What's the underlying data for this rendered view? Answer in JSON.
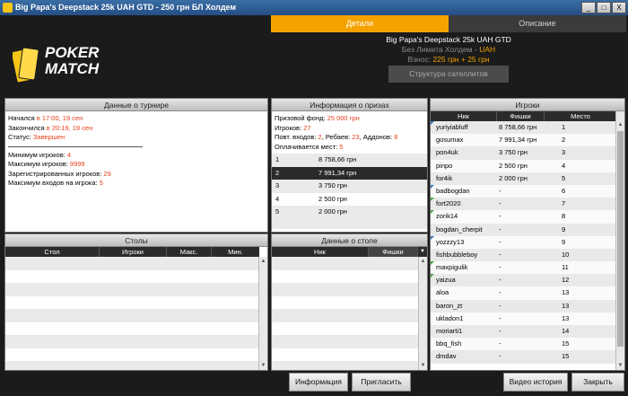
{
  "window": {
    "title": "Big Papa's Deepstack 25k UAH GTD - 250 грн БЛ Холдем",
    "min": "_",
    "max": "□",
    "close": "X"
  },
  "logo": {
    "line1": "POKER",
    "line2": "MATCH"
  },
  "tabs": {
    "details": "Детали",
    "description": "Описание"
  },
  "tournament_header": {
    "name": "Big Papa's Deepstack 25k UAH GTD",
    "game_prefix": "Без Лимита Холдем - ",
    "game_currency": "UAH",
    "buyin_label": "Взнос: ",
    "buyin_value": "225 грн + 25 грн",
    "satellites_button": "Структура сателлитов"
  },
  "tournament_data": {
    "title": "Данные о турнире",
    "started_label": "Начался ",
    "started_value": "в 17:00, 19 сен",
    "ended_label": "Закончился ",
    "ended_value": "в 20:19, 19 сен",
    "status_label": "Статус: ",
    "status_value": "Завершен",
    "min_players_label": "Минимум игроков: ",
    "min_players_value": "4",
    "max_players_label": "Максимум игроков: ",
    "max_players_value": "9999",
    "registered_label": "Зарегистрированных игроков: ",
    "registered_value": "29",
    "max_entries_label": "Максимум входов на игрока: ",
    "max_entries_value": "5"
  },
  "prizes": {
    "title": "Информация о призах",
    "pool_label": "Призовой фонд: ",
    "pool_value": "25 000 грн",
    "players_label": "Игроков: ",
    "players_value": "27",
    "reentries_label": "Повт. входов: ",
    "reentries_value": "2",
    "rebuys_label": ", Ребаев: ",
    "rebuys_value": "23",
    "addons_label": ", Аддонов: ",
    "addons_value": "8",
    "paid_label": "Оплачивается мест: ",
    "paid_value": "5",
    "places": [
      {
        "place": "1",
        "prize": "8 758,66 грн"
      },
      {
        "place": "2",
        "prize": "7 991,34 грн"
      },
      {
        "place": "3",
        "prize": "3 750 грн"
      },
      {
        "place": "4",
        "prize": "2 500 грн"
      },
      {
        "place": "5",
        "prize": "2 000 грн"
      }
    ]
  },
  "players": {
    "title": "Игроки",
    "columns": {
      "nick": "Ник",
      "chips": "Фишки",
      "place": "Место"
    },
    "rows": [
      {
        "nick": "yuriyiabluff",
        "chips": "8 758,66 грн",
        "place": "1",
        "flag": "blue"
      },
      {
        "nick": "gosumax",
        "chips": "7 991,34 грн",
        "place": "2",
        "flag": ""
      },
      {
        "nick": "pon4uk",
        "chips": "3 750 грн",
        "place": "3",
        "flag": ""
      },
      {
        "nick": "pinpo",
        "chips": "2 500 грн",
        "place": "4",
        "flag": ""
      },
      {
        "nick": "for4ik",
        "chips": "2 000 грн",
        "place": "5",
        "flag": ""
      },
      {
        "nick": "badbogdan",
        "chips": "-",
        "place": "6",
        "flag": "blue"
      },
      {
        "nick": "fort2020",
        "chips": "-",
        "place": "7",
        "flag": "green"
      },
      {
        "nick": "zorik14",
        "chips": "-",
        "place": "8",
        "flag": "green"
      },
      {
        "nick": "bogdan_cherpit",
        "chips": "-",
        "place": "9",
        "flag": ""
      },
      {
        "nick": "yozzzy13",
        "chips": "-",
        "place": "9",
        "flag": "blue"
      },
      {
        "nick": "fishbubbleboy",
        "chips": "-",
        "place": "10",
        "flag": ""
      },
      {
        "nick": "maxpigulik",
        "chips": "-",
        "place": "11",
        "flag": "green"
      },
      {
        "nick": "yaizua",
        "chips": "-",
        "place": "12",
        "flag": "green"
      },
      {
        "nick": "aloa",
        "chips": "-",
        "place": "13",
        "flag": ""
      },
      {
        "nick": "baron_zt",
        "chips": "-",
        "place": "13",
        "flag": ""
      },
      {
        "nick": "ukladon1",
        "chips": "-",
        "place": "13",
        "flag": ""
      },
      {
        "nick": "moriarti1",
        "chips": "-",
        "place": "14",
        "flag": ""
      },
      {
        "nick": "bbq_fish",
        "chips": "-",
        "place": "15",
        "flag": ""
      },
      {
        "nick": "dmdav",
        "chips": "-",
        "place": "15",
        "flag": ""
      }
    ]
  },
  "tables": {
    "title": "Столы",
    "columns": {
      "table": "Стол",
      "players": "Игроки",
      "max": "Макс.",
      "min": "Мин."
    }
  },
  "table_data": {
    "title": "Данные о столе",
    "columns": {
      "nick": "Ник",
      "chips": "Фишки"
    }
  },
  "buttons": {
    "info": "Информация",
    "invite": "Пригласить",
    "video": "Видео история",
    "close": "Закрыть"
  }
}
